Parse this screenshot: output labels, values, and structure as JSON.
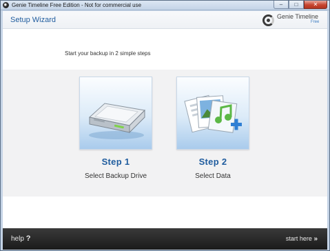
{
  "window": {
    "title": "Genie Timeline Free Edition - Not for commercial use",
    "minimize_glyph": "–",
    "maximize_glyph": "□",
    "close_glyph": "✕"
  },
  "header": {
    "title": "Setup Wizard",
    "brand_name": "Genie Timeline",
    "brand_edition": "Free"
  },
  "main": {
    "subtitle": "Start your backup in 2 simple steps",
    "steps": [
      {
        "label": "Step 1",
        "description": "Select Backup Drive",
        "icon": "hard-drive-icon"
      },
      {
        "label": "Step 2",
        "description": "Select Data",
        "icon": "data-files-icon"
      }
    ]
  },
  "footer": {
    "help_label": "help",
    "help_glyph": "?",
    "start_label": "start here",
    "start_glyph": "»"
  },
  "colors": {
    "accent_blue": "#1f5c9e",
    "footer_bg": "#1b1b1b",
    "band_bg": "#f2f2f3"
  }
}
